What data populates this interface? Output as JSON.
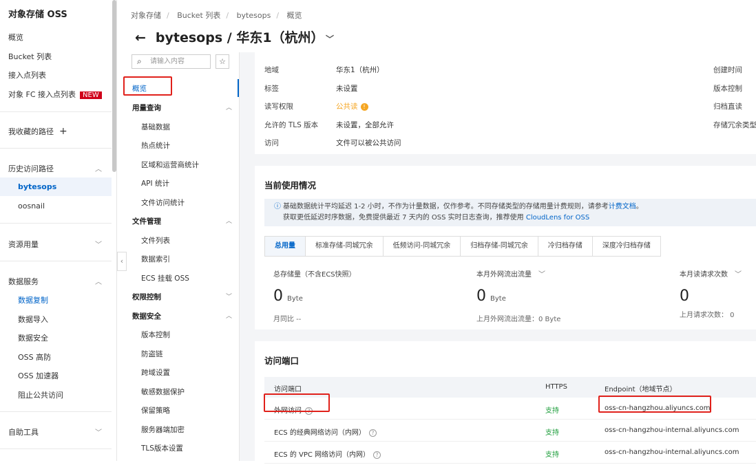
{
  "sidebar": {
    "title": "对象存储 OSS",
    "items": [
      "概览",
      "Bucket 列表",
      "接入点列表",
      "对象 FC 接入点列表"
    ],
    "new_badge": "NEW",
    "favorites": "我收藏的路径",
    "history": "历史访问路径",
    "history_items": [
      "bytesops",
      "oosnail"
    ],
    "resource": "资源用量",
    "data_service": "数据服务",
    "data_items": [
      "数据复制",
      "数据导入",
      "数据安全",
      "OSS 高防",
      "OSS 加速器",
      "阻止公共访问"
    ],
    "tools": "自助工具"
  },
  "breadcrumb": [
    "对象存储",
    "Bucket 列表",
    "bytesops",
    "概览"
  ],
  "page_title": "bytesops / 华东1（杭州）",
  "nav": {
    "search_placeholder": "请输入内容",
    "overview": "概览",
    "groups": [
      {
        "label": "用量查询",
        "items": [
          "基础数据",
          "热点统计",
          "区域和运营商统计",
          "API 统计",
          "文件访问统计"
        ]
      },
      {
        "label": "文件管理",
        "items": [
          "文件列表",
          "数据索引",
          "ECS 挂载 OSS"
        ]
      },
      {
        "label": "权限控制",
        "items": []
      },
      {
        "label": "数据安全",
        "items": [
          "版本控制",
          "防盗链",
          "跨域设置",
          "敏感数据保护",
          "保留策略",
          "服务器端加密",
          "TLS版本设置"
        ]
      }
    ]
  },
  "info": {
    "rows": [
      {
        "label": "地域",
        "value": "华东1（杭州）"
      },
      {
        "label": "标签",
        "value": "未设置"
      },
      {
        "label": "读写权限",
        "value": "公共读"
      },
      {
        "label": "允许的 TLS 版本",
        "value": "未设置，全部允许"
      },
      {
        "label": "访问",
        "value": "文件可以被公共访问"
      }
    ],
    "right_labels": [
      "创建时间",
      "版本控制",
      "归档直读",
      "存储冗余类型"
    ]
  },
  "usage": {
    "title": "当前使用情况",
    "note1": "基础数据统计平均延迟 1-2 小时，不作为计量数据，仅作参考。不同存储类型的存储用量计费规则，请参考",
    "note_link": "计费文档",
    "note1_end": "。",
    "note2": "获取更低延迟时序数据，免费提供最近 7 天内的 OSS 实时日志查询，推荐使用",
    "note2_link": "CloudLens for OSS",
    "tabs": [
      "总用量",
      "标准存储-同城冗余",
      "低频访问-同城冗余",
      "归档存储-同城冗余",
      "冷归档存储",
      "深度冷归档存储"
    ],
    "metrics": [
      {
        "label": "总存储量（不含ECS快照）",
        "value": "0",
        "unit": "Byte",
        "sub": "月同比 --"
      },
      {
        "label": "本月外网流出流量",
        "value": "0",
        "unit": "Byte",
        "sub": "上月外网流出流量：0 Byte"
      },
      {
        "label": "本月读请求次数",
        "value": "0",
        "unit": "",
        "sub": "上月请求次数：  0"
      }
    ]
  },
  "endpoints": {
    "title": "访问端口",
    "headers": [
      "访问端口",
      "HTTPS",
      "Endpoint（地域节点）"
    ],
    "rows": [
      {
        "name": "外网访问",
        "https": "支持",
        "endpoint": "oss-cn-hangzhou.aliyuncs.com"
      },
      {
        "name": "ECS 的经典网络访问（内网）",
        "https": "支持",
        "endpoint": "oss-cn-hangzhou-internal.aliyuncs.com"
      },
      {
        "name": "ECS 的 VPC 网络访问（内网）",
        "https": "支持",
        "endpoint": "oss-cn-hangzhou-internal.aliyuncs.com"
      }
    ]
  },
  "colors": {
    "accent": "#0064c8",
    "warn": "#f5a623",
    "ok": "#1e9e3c",
    "highlight": "#e0201a"
  }
}
